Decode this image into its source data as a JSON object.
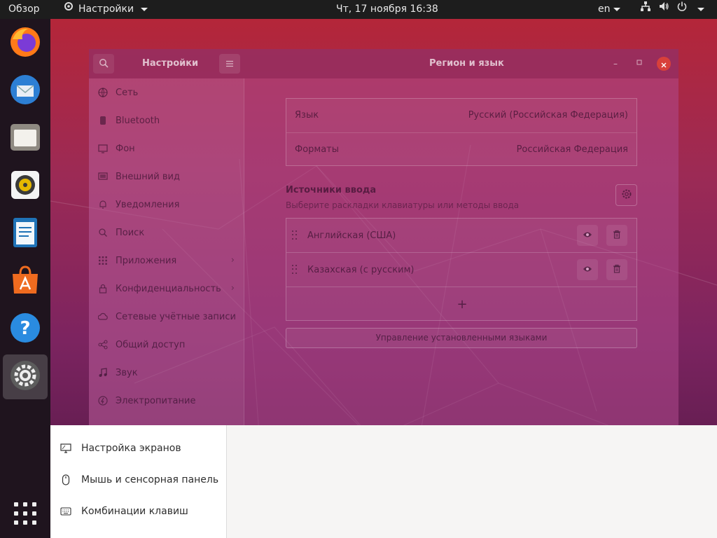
{
  "topbar": {
    "overview": "Обзор",
    "app_menu": "Настройки",
    "clock": "Чт, 17 ноября  16:38",
    "language": "en"
  },
  "dock": {
    "items": [
      "firefox-icon",
      "thunderbird-icon",
      "files-icon",
      "rhythmbox-icon",
      "writer-icon",
      "software-icon",
      "help-icon",
      "settings-icon"
    ],
    "active": "settings-icon"
  },
  "window": {
    "left_title": "Настройки",
    "right_title": "Регион и язык"
  },
  "sidebar": {
    "items": [
      {
        "label": "Сеть",
        "icon": "network-icon"
      },
      {
        "label": "Bluetooth",
        "icon": "bluetooth-icon"
      },
      {
        "label": "Фон",
        "icon": "background-icon"
      },
      {
        "label": "Внешний вид",
        "icon": "appearance-icon"
      },
      {
        "label": "Уведомления",
        "icon": "bell-icon"
      },
      {
        "label": "Поиск",
        "icon": "search-icon"
      },
      {
        "label": "Приложения",
        "icon": "apps-icon"
      },
      {
        "label": "Конфиденциальность",
        "icon": "lock-icon"
      },
      {
        "label": "Сетевые учётные записи",
        "icon": "cloud-icon"
      },
      {
        "label": "Общий доступ",
        "icon": "share-icon"
      },
      {
        "label": "Звук",
        "icon": "music-icon"
      },
      {
        "label": "Электропитание",
        "icon": "power-icon"
      }
    ]
  },
  "region": {
    "language_label": "Язык",
    "language_value": "Русский (Российская Федерация)",
    "formats_label": "Форматы",
    "formats_value": "Российская Федерация",
    "sources_title": "Источники ввода",
    "sources_subtitle": "Выберите раскладки клавиатуры или методы ввода",
    "sources": [
      "Английская (США)",
      "Казахская (с русским)"
    ],
    "add_symbol": "+",
    "manage_button": "Управление установленными языками"
  },
  "popup": {
    "items": [
      {
        "label": "Настройка экранов",
        "icon": "display-icon"
      },
      {
        "label": "Мышь и сенсорная панель",
        "icon": "mouse-icon"
      },
      {
        "label": "Комбинации клавиш",
        "icon": "keyboard-icon"
      }
    ]
  }
}
